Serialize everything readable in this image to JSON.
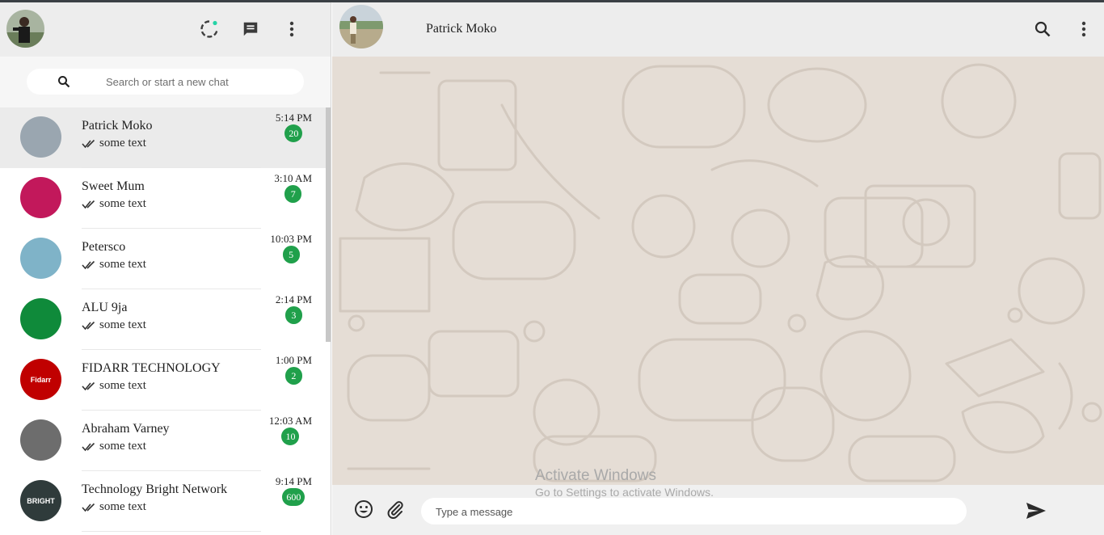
{
  "sidebar": {
    "search": {
      "placeholder": "Search or start a new chat"
    },
    "chats": [
      {
        "name": "Patrick Moko",
        "preview": "some text",
        "time": "5:14 PM",
        "unread": "20",
        "active": true,
        "avatar_color": "#9aa6b0"
      },
      {
        "name": "Sweet Mum",
        "preview": "some text",
        "time": "3:10 AM",
        "unread": "7",
        "avatar_color": "#c2185b"
      },
      {
        "name": "Petersco",
        "preview": "some text",
        "time": "10:03 PM",
        "unread": "5",
        "avatar_color": "#7fb3c8"
      },
      {
        "name": "ALU 9ja",
        "preview": "some text",
        "time": "2:14 PM",
        "unread": "3",
        "avatar_color": "#0f8a3a"
      },
      {
        "name": "FIDARR TECHNOLOGY",
        "preview": "some text",
        "time": "1:00 PM",
        "unread": "2",
        "avatar_color": "#c00000",
        "avatar_text": "Fidarr"
      },
      {
        "name": "Abraham Varney",
        "preview": "some text",
        "time": "12:03 AM",
        "unread": "10",
        "avatar_color": "#6d6d6d"
      },
      {
        "name": "Technology Bright Network",
        "preview": "some text",
        "time": "9:14 PM",
        "unread": "600",
        "avatar_color": "#2f3b3b",
        "avatar_text": "BRIGHT"
      }
    ]
  },
  "conversation": {
    "contact_name": "Patrick Moko",
    "message_placeholder": "Type a message"
  },
  "watermark": {
    "line1": "Activate Windows",
    "line2": "Go to Settings to activate Windows."
  },
  "colors": {
    "badge": "#20a04b",
    "chat_background": "#e5ddd5",
    "header": "#ededed",
    "status_dot": "#25d3a6"
  }
}
